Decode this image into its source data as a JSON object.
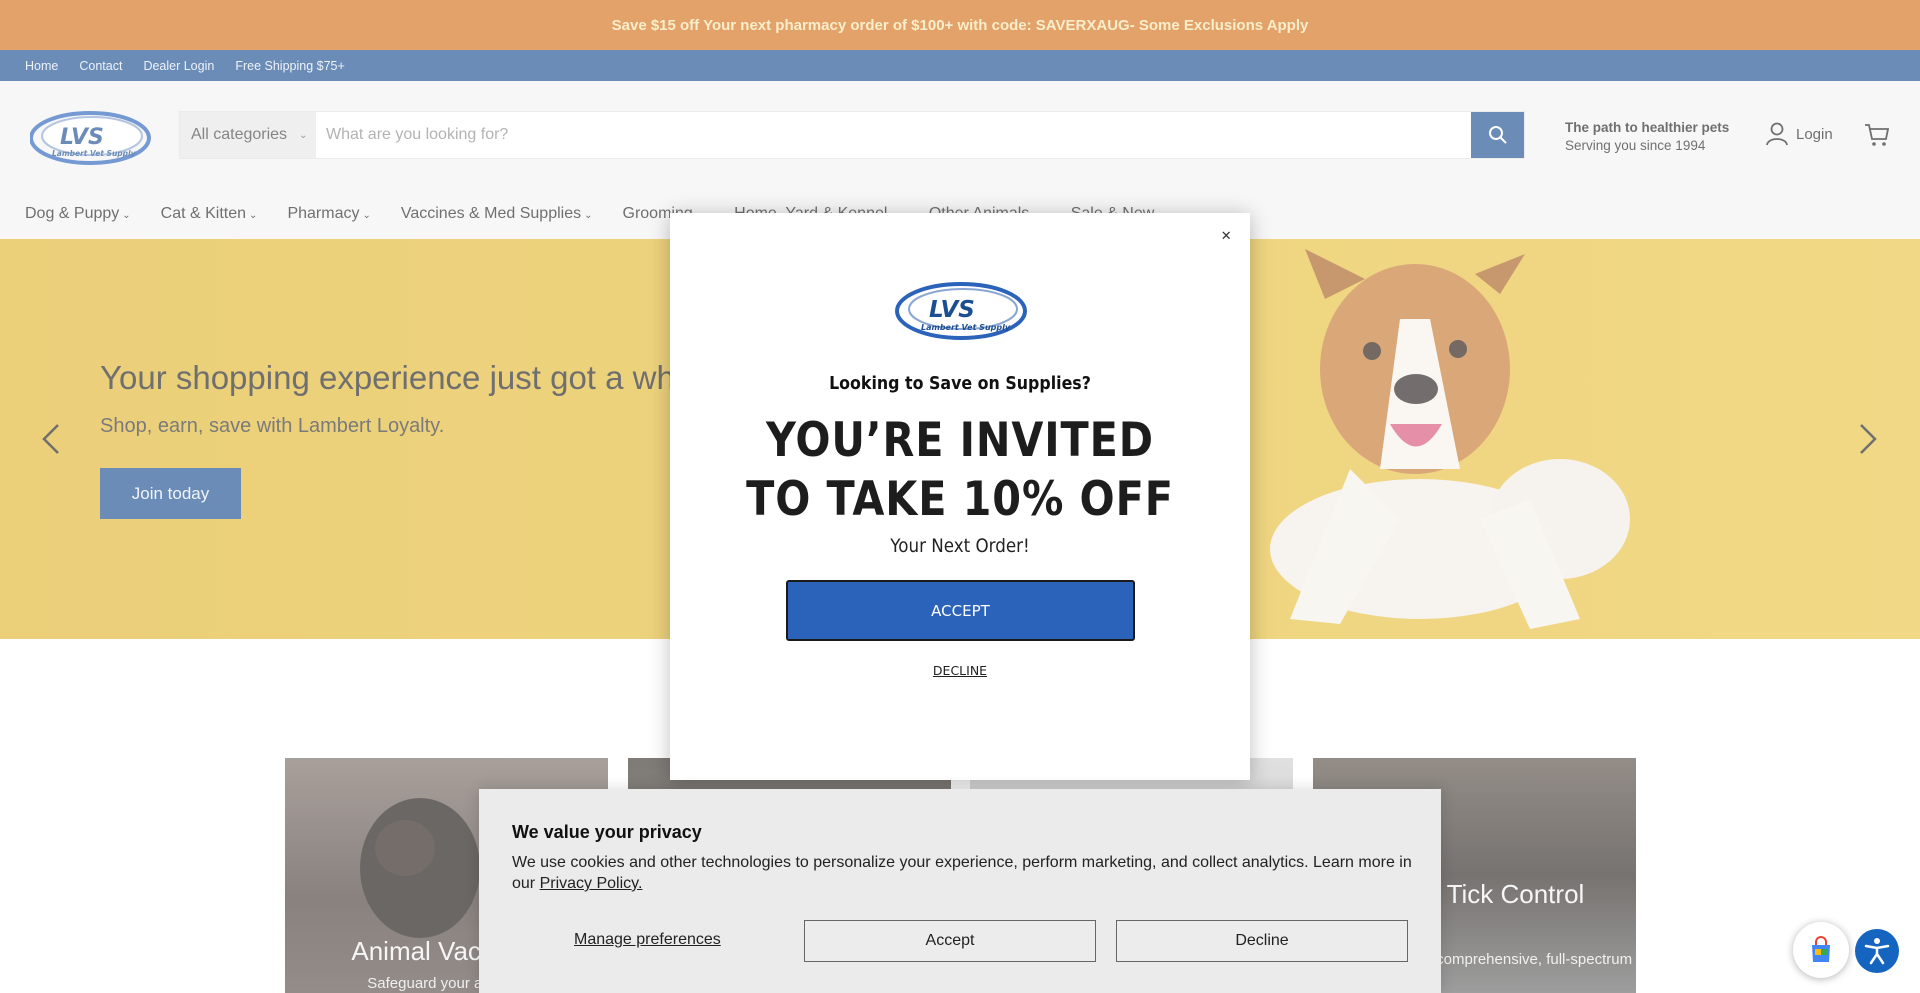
{
  "promo": {
    "text": "Save $15 off Your next pharmacy order of $100+ with code: SAVERXAUG- Some Exclusions Apply"
  },
  "utility_nav": [
    "Home",
    "Contact",
    "Dealer Login",
    "Free Shipping $75+"
  ],
  "header": {
    "logo_text": "LVS",
    "logo_sub": "Lambert Vet Supply",
    "category_select": "All categories",
    "search_placeholder": "What are you looking for?",
    "tagline_1": "The path to healthier pets",
    "tagline_2": "Serving you since 1994",
    "login_label": "Login"
  },
  "main_nav": [
    "Dog & Puppy",
    "Cat & Kitten",
    "Pharmacy",
    "Vaccines & Med Supplies",
    "Grooming",
    "Home, Yard & Kennel",
    "Other Animals",
    "Sale & New"
  ],
  "hero": {
    "title": "Your shopping experience just got a whole lot better.",
    "subtitle": "Shop, earn, save with Lambert Loyalty.",
    "cta": "Join today"
  },
  "tiles": [
    {
      "title": "Animal Vaccines",
      "desc": "Safeguard your animals"
    },
    {
      "title": "",
      "desc": ""
    },
    {
      "title": "",
      "desc": ""
    },
    {
      "title": "Flea & Tick Control",
      "desc": "Beat the bite with comprehensive, full-spectrum"
    }
  ],
  "modal": {
    "close": "✕",
    "question": "Looking to Save on Supplies?",
    "headline_1": "YOU’RE INVITED",
    "headline_2": "TO TAKE 10% OFF",
    "next": "Your Next Order!",
    "accept": "ACCEPT",
    "decline": "DECLINE"
  },
  "privacy": {
    "title": "We value your privacy",
    "text": "We use cookies and other technologies to personalize your experience, perform marketing, and collect analytics. Learn more in our",
    "link": "Privacy Policy.",
    "manage": "Manage preferences",
    "accept": "Accept",
    "decline": "Decline"
  },
  "colors": {
    "promo": "#d5711a",
    "navy": "#1c4f91",
    "hero": "#e6bd3a",
    "modal_accept": "#2b63bb"
  }
}
